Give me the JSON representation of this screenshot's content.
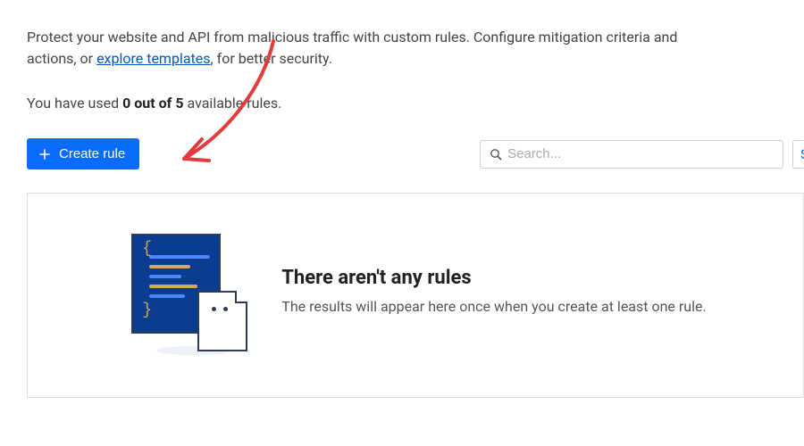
{
  "intro": {
    "before_link": "Protect your website and API from malicious traffic with custom rules. Configure mitigation criteria and actions, or ",
    "link_text": "explore templates",
    "after_link": ", for better security."
  },
  "usage": {
    "prefix": "You have used ",
    "count": "0 out of 5",
    "suffix": " available rules."
  },
  "toolbar": {
    "create_label": "Create rule",
    "search_placeholder": "Search...",
    "side_letter": "S"
  },
  "empty_state": {
    "title": "There aren't any rules",
    "subtitle": "The results will appear here once when you create at least one rule."
  },
  "colors": {
    "primary": "#0a6cff",
    "annotation": "#e23b3b"
  }
}
